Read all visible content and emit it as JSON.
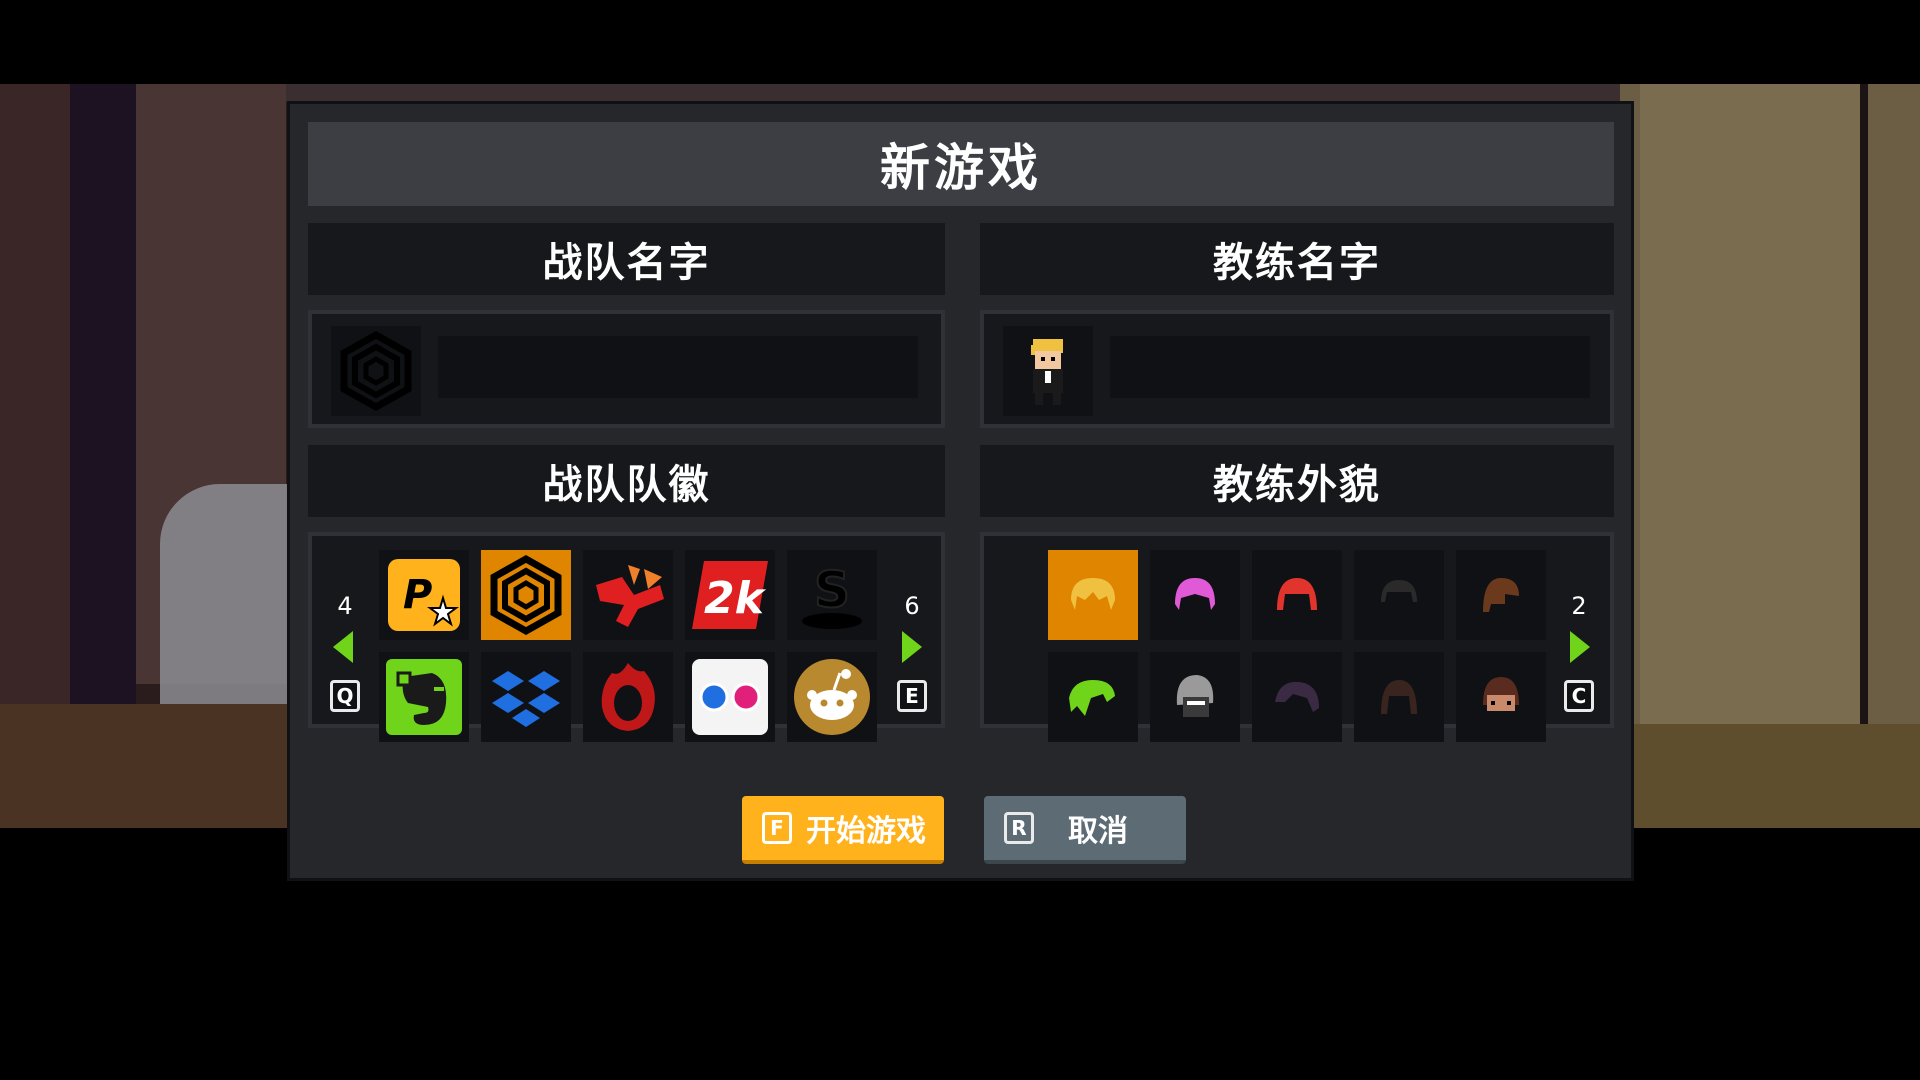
{
  "dialog": {
    "title": "新游戏"
  },
  "team_name": {
    "header": "战队名字",
    "value": "",
    "emblem_icon": "spiral-emblem-icon"
  },
  "coach_name": {
    "header": "教练名字",
    "value": "",
    "avatar_icon": "coach-avatar-icon"
  },
  "team_emblem": {
    "header": "战队队徽",
    "prev_page": "4",
    "next_page": "6",
    "prev_key": "Q",
    "next_key": "E",
    "items": [
      {
        "icon": "p-logo-icon",
        "selected": false
      },
      {
        "icon": "spiral-emblem-icon",
        "selected": true
      },
      {
        "icon": "red-x-icon",
        "selected": false
      },
      {
        "icon": "2k-logo-icon",
        "selected": false
      },
      {
        "icon": "s-logo-icon",
        "selected": false
      },
      {
        "icon": "elephant-logo-icon",
        "selected": false
      },
      {
        "icon": "dropbox-logo-icon",
        "selected": false
      },
      {
        "icon": "red-flame-ring-icon",
        "selected": false
      },
      {
        "icon": "flickr-dots-icon",
        "selected": false
      },
      {
        "icon": "reddit-alien-icon",
        "selected": false
      }
    ]
  },
  "coach_look": {
    "header": "教练外貌",
    "next_page": "2",
    "next_key": "C",
    "items": [
      {
        "icon": "hair-blonde-icon",
        "color": "#f0c040",
        "selected": true
      },
      {
        "icon": "hair-pink-icon",
        "color": "#e05ad8",
        "selected": false
      },
      {
        "icon": "hair-red-icon",
        "color": "#e0342c",
        "selected": false
      },
      {
        "icon": "hair-black-icon",
        "color": "#202020",
        "selected": false
      },
      {
        "icon": "hair-brown-icon",
        "color": "#6b3a1c",
        "selected": false
      },
      {
        "icon": "hair-green-icon",
        "color": "#6fd41a",
        "selected": false
      },
      {
        "icon": "hair-grey-helmet-icon",
        "color": "#9a9a9a",
        "selected": false
      },
      {
        "icon": "hair-purple-icon",
        "color": "#3a2a44",
        "selected": false
      },
      {
        "icon": "hair-darkbrown-icon",
        "color": "#3a2420",
        "selected": false
      },
      {
        "icon": "hair-brown-face-icon",
        "color": "#5a2c20",
        "selected": false
      }
    ]
  },
  "buttons": {
    "start_key": "F",
    "start_label": "开始游戏",
    "cancel_key": "R",
    "cancel_label": "取消"
  },
  "colors": {
    "accent": "#e08500",
    "start_button": "#ffb21c",
    "cancel_button": "#5d6b74",
    "arrow": "#6fd41a"
  }
}
